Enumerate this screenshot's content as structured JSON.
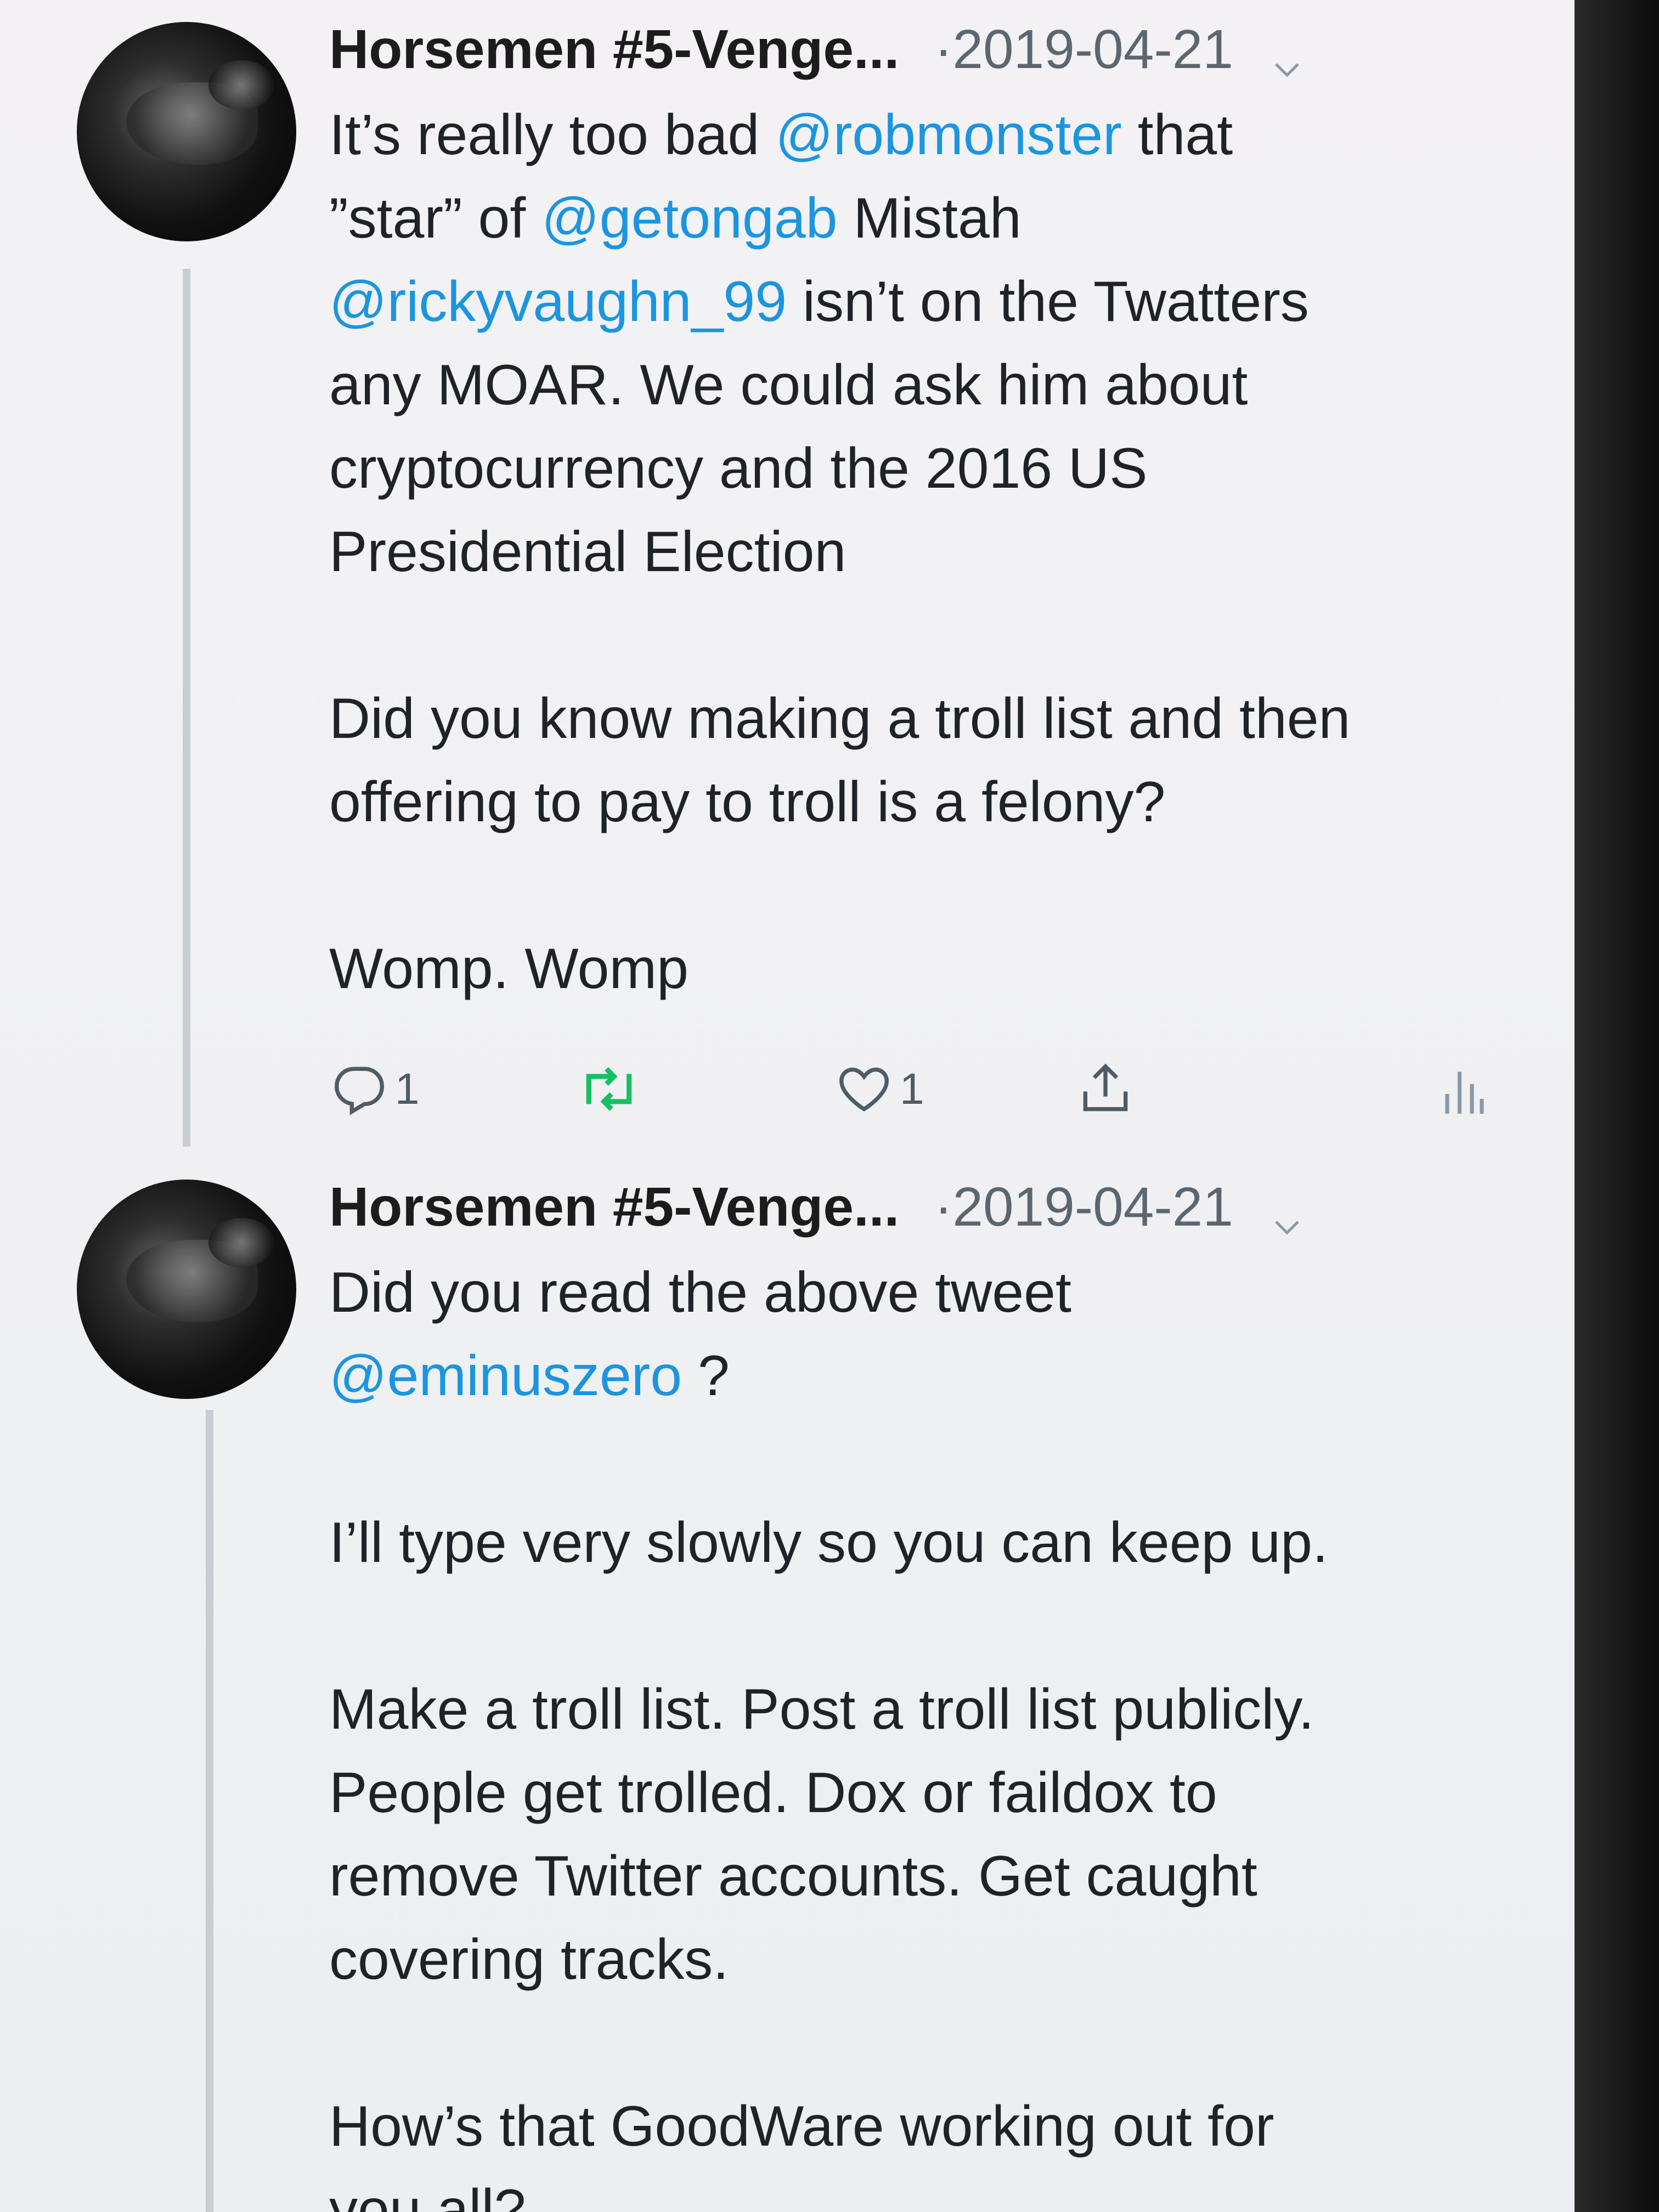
{
  "tweets": [
    {
      "author": "Horsemen #5-Venge...",
      "date": "·2019-04-21",
      "lines": [
        [
          {
            "t": "It’s really too bad "
          },
          {
            "m": "@robmonster"
          },
          {
            "t": " that"
          }
        ],
        [
          {
            "t": "”star” of "
          },
          {
            "m": "@getongab"
          },
          {
            "t": " Mistah"
          }
        ],
        [
          {
            "m": "@rickyvaughn_99"
          },
          {
            "t": " isn’t on the Twatters"
          }
        ],
        [
          {
            "t": "any MOAR. We could ask him about"
          }
        ],
        [
          {
            "t": "cryptocurrency and the 2016 US"
          }
        ],
        [
          {
            "t": "Presidential Election"
          }
        ],
        null,
        [
          {
            "t": "Did you know making a troll list and then"
          }
        ],
        [
          {
            "t": "offering to pay to troll is a felony?"
          }
        ],
        null,
        [
          {
            "t": "Womp. Womp"
          }
        ]
      ],
      "actions": {
        "reply_count": "1",
        "retweet_count": "",
        "like_count": "1"
      },
      "icons": {
        "reply": "reply-icon",
        "retweet": "retweet-icon",
        "like": "heart-icon",
        "share": "share-icon",
        "analytics": "analytics-icon",
        "caret": "chevron-down-icon"
      },
      "colors": {
        "retweet": "#17bf63"
      }
    },
    {
      "author": "Horsemen #5-Venge...",
      "date": "·2019-04-21",
      "lines": [
        [
          {
            "t": "Did you read the above tweet"
          }
        ],
        [
          {
            "m": "@eminuszero"
          },
          {
            "t": " ?"
          }
        ],
        null,
        [
          {
            "t": "I’ll type very slowly so you can keep up."
          }
        ],
        null,
        [
          {
            "t": "Make a troll list. Post a troll list publicly."
          }
        ],
        [
          {
            "t": "People get trolled. Dox or faildox to"
          }
        ],
        [
          {
            "t": "remove Twitter accounts. Get caught"
          }
        ],
        [
          {
            "t": "covering tracks."
          }
        ],
        null,
        [
          {
            "t": "How’s that GoodWare working out for"
          }
        ],
        [
          {
            "t": "you all?"
          }
        ]
      ]
    }
  ],
  "colors": {
    "mention": "#1b95e0",
    "text": "#1f2226",
    "muted": "#5b6670"
  }
}
